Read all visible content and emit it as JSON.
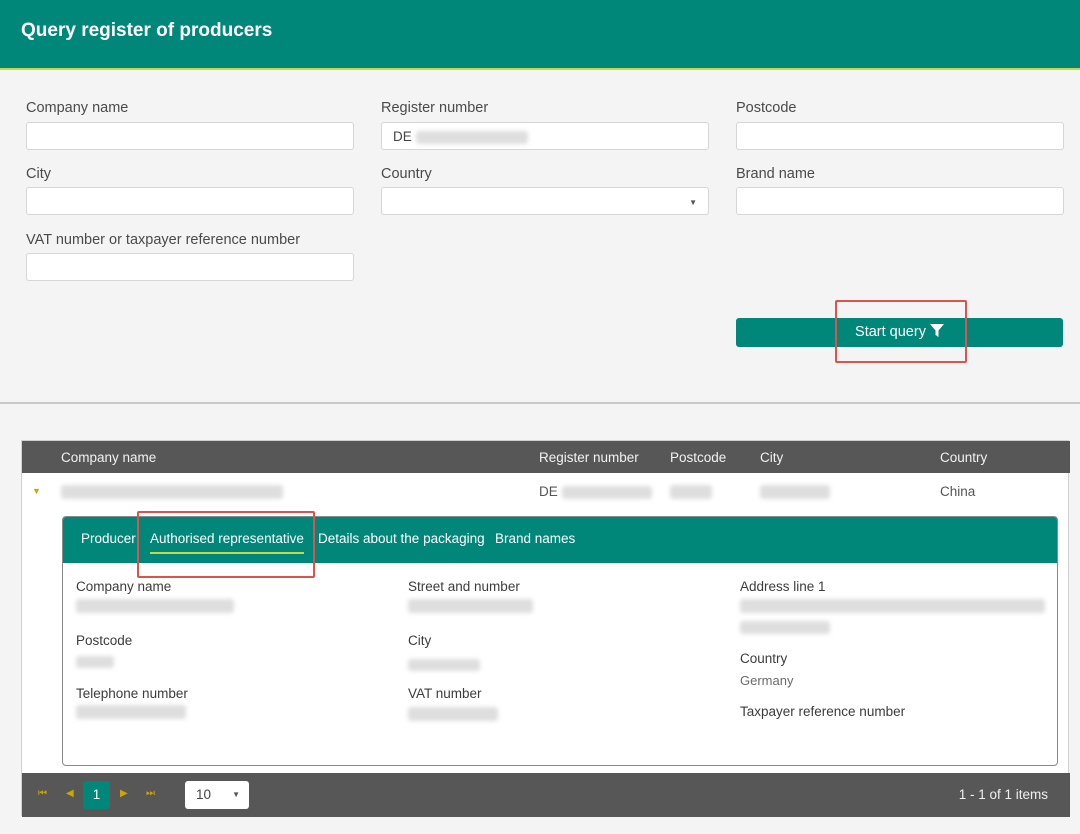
{
  "header": {
    "title": "Query register of producers"
  },
  "form": {
    "company_name_label": "Company name",
    "register_number_label": "Register number",
    "register_number_value": "DE",
    "postcode_label": "Postcode",
    "city_label": "City",
    "country_label": "Country",
    "brand_name_label": "Brand name",
    "vat_label": "VAT number or taxpayer reference number",
    "start_query_label": "Start query"
  },
  "results": {
    "columns": [
      "Company name",
      "Register number",
      "Postcode",
      "City",
      "Country"
    ],
    "row": {
      "register_number": "DE",
      "country": "China"
    },
    "tabs": [
      "Producer",
      "Authorised representative",
      "Details about the packaging",
      "Brand names"
    ],
    "active_tab": "Authorised representative",
    "details": {
      "company_name_label": "Company name",
      "street_label": "Street and number",
      "address_line1_label": "Address line 1",
      "postcode_label": "Postcode",
      "city_label": "City",
      "country_label": "Country",
      "country_value": "Germany",
      "telephone_label": "Telephone number",
      "vat_label": "VAT number",
      "taxpayer_label": "Taxpayer reference number"
    }
  },
  "pager": {
    "current_page": "1",
    "page_size": "10",
    "info": "1 - 1 of 1 items"
  },
  "icons": [
    "filter-icon",
    "expand-caret-icon",
    "first-page-icon",
    "prev-page-icon",
    "next-page-icon",
    "last-page-icon",
    "dropdown-arrow-icon"
  ],
  "colors": {
    "primary": "#00877a",
    "accent": "#c9d64a",
    "highlight": "#d9534f",
    "grid_header": "#575757"
  }
}
